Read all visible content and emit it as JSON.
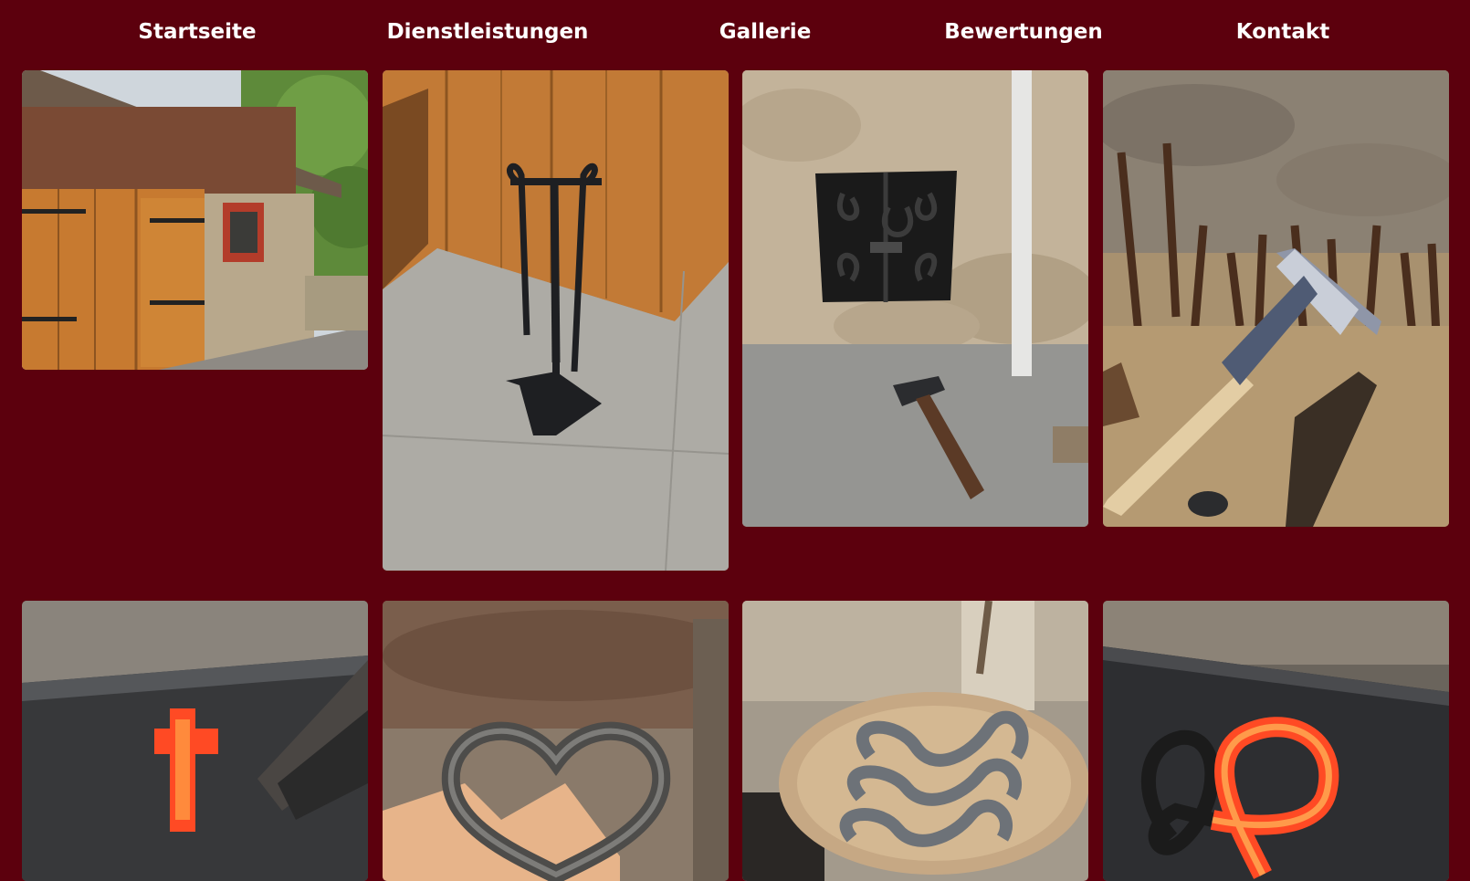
{
  "nav": {
    "items": [
      {
        "label": "Startseite"
      },
      {
        "label": "Dienstleistungen"
      },
      {
        "label": "Gallerie"
      },
      {
        "label": "Bewertungen"
      },
      {
        "label": "Kontakt"
      }
    ]
  },
  "colors": {
    "background": "#5c000d",
    "nav_text": "#ffffff"
  },
  "gallery": {
    "photos": [
      {
        "subject": "wooden workshop shed with stone wall and brick window"
      },
      {
        "subject": "wrought iron fireplace tool stand against wooden door"
      },
      {
        "subject": "stone wall with forged window grille and a hammer on floor"
      },
      {
        "subject": "pickaxe leaning over a pile of rusty iron scraps"
      },
      {
        "subject": "glowing red-hot forged cross on an anvil"
      },
      {
        "subject": "hand holding a heart made of two horseshoes"
      },
      {
        "subject": "forged iron wave shapes on a wooden stump"
      },
      {
        "subject": "glowing forged twisted loop on an anvil"
      }
    ]
  }
}
